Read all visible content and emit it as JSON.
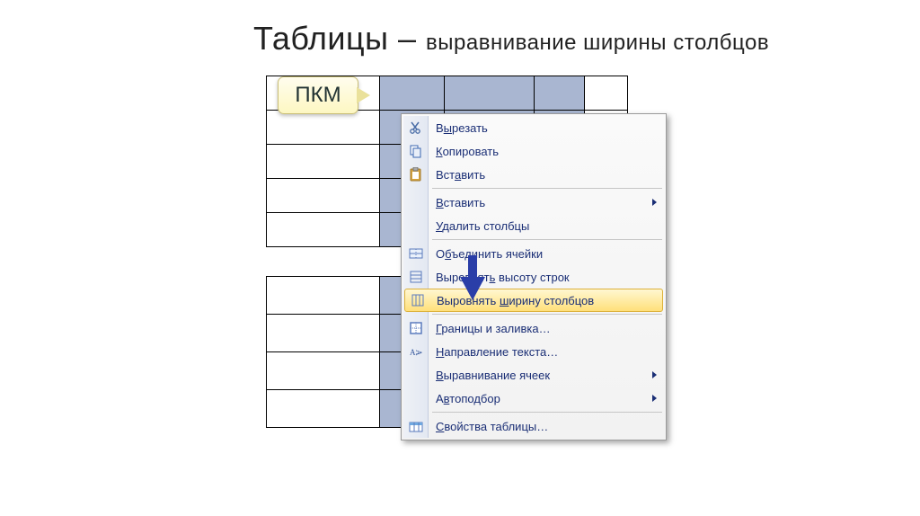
{
  "heading": {
    "main": "Таблицы – ",
    "sub": "выравнивание ширины столбцов"
  },
  "callout": {
    "label": "ПКМ"
  },
  "menu": {
    "cut": "Вырезать",
    "copy": "Копировать",
    "paste": "Вставить",
    "insert": "Вставить",
    "delete_cols": "Удалить столбцы",
    "merge": "Объединить ячейки",
    "dist_rows": "Выровнять высоту строк",
    "dist_cols": "Выровнять ширину столбцов",
    "borders": "Границы и заливка…",
    "text_dir": "Направление текста…",
    "align": "Выравнивание ячеек",
    "autofit": "Автоподбор",
    "props": "Свойства таблицы…"
  }
}
